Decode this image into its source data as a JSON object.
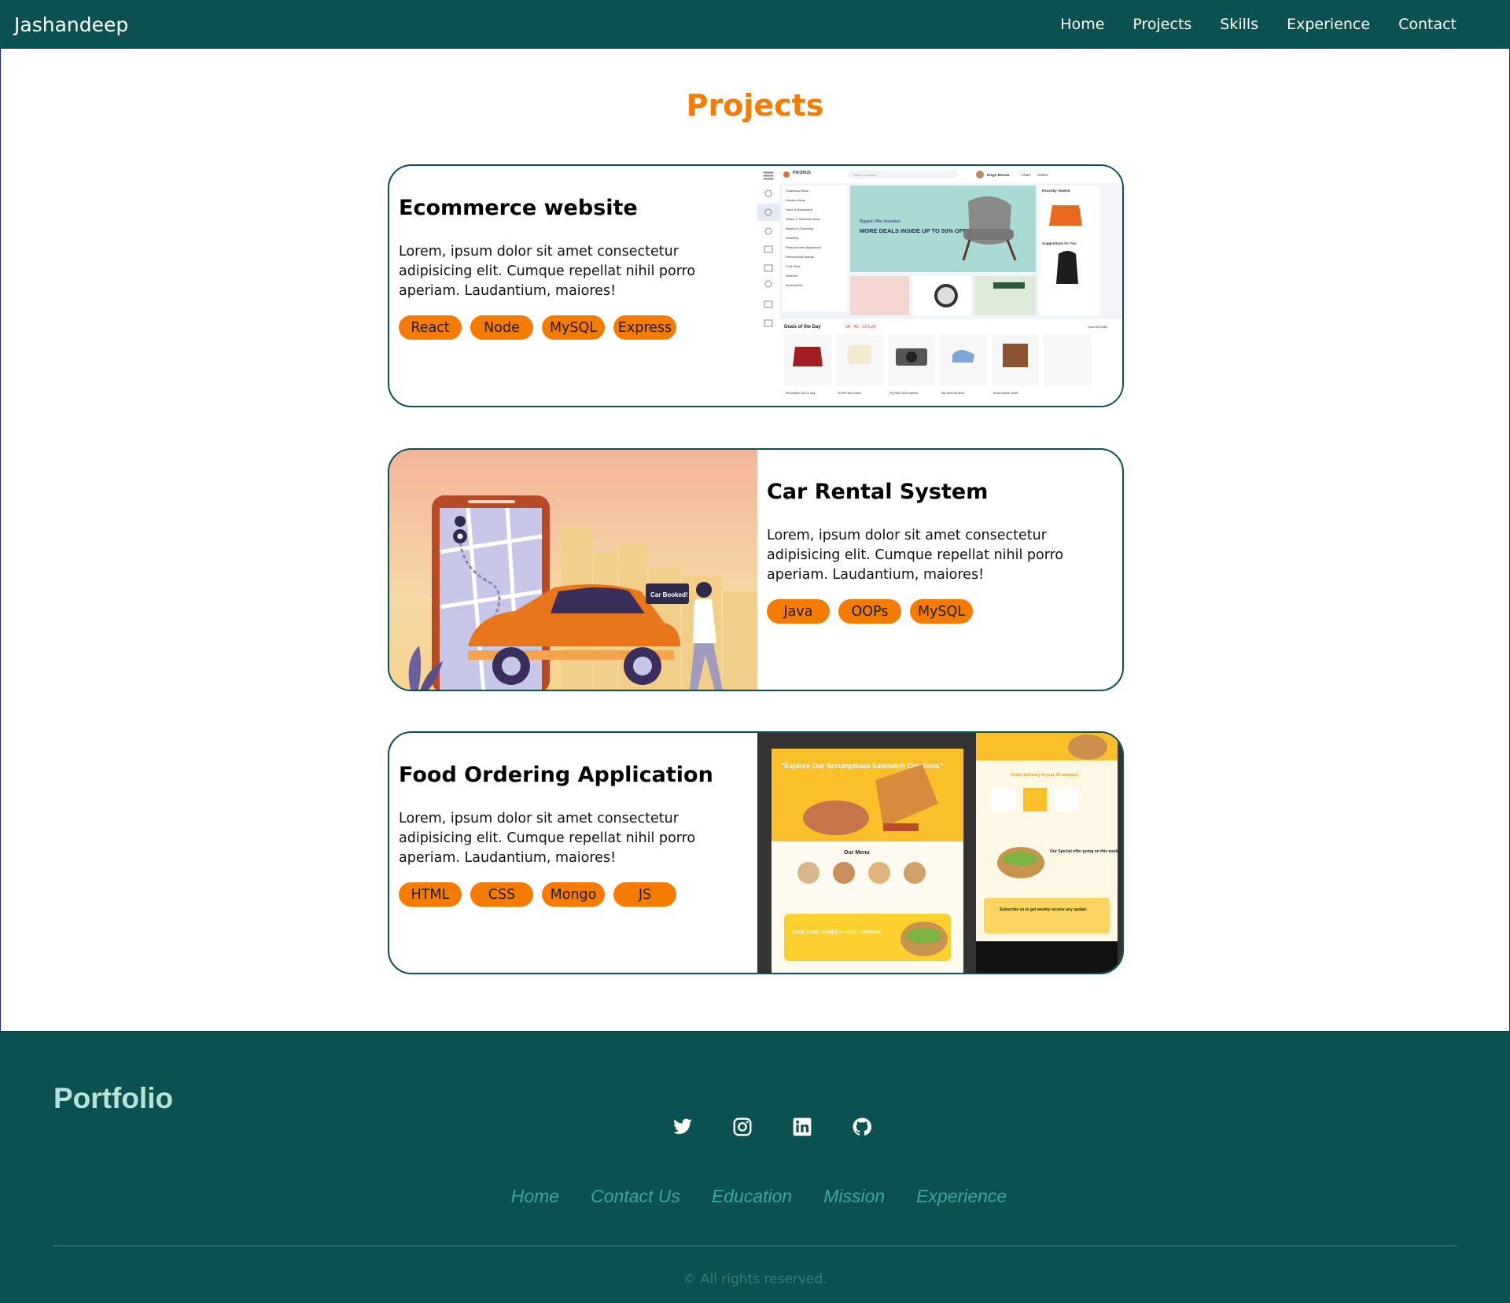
{
  "navbar": {
    "brand": "Jashandeep",
    "links": [
      "Home",
      "Projects",
      "Skills",
      "Experience",
      "Contact"
    ]
  },
  "projects_section": {
    "title": "Projects",
    "cards": [
      {
        "title": "Ecommerce website",
        "description": "Lorem, ipsum dolor sit amet consectetur adipisicing elit. Cumque repellat nihil porro aperiam. Laudantium, maiores!",
        "tags": [
          "React",
          "Node",
          "MySQL",
          "Express"
        ],
        "screenshot": {
          "logo": "PIKORUS",
          "search_placeholder": "Search products",
          "user": "Diego Morata",
          "header_links": [
            "Chart",
            "Orders"
          ],
          "categories": [
            "Traditional Wear",
            "Western Wear",
            "Swim & Beachwear",
            "Winter & Seasonal Wear",
            "Beauty & Grooming",
            "Jewellery",
            "Personal care Appliances",
            "International Brands",
            "Foot Wear",
            "Watches",
            "Accessories"
          ],
          "banner_small": "Biggest Offer Revealed",
          "banner_big": "MORE DEALS INSIDE UP TO 50% OFF",
          "recently_viewed": "Recently Viewed",
          "suggestions": "Suggestions for You",
          "deals_title": "Deals of the Day",
          "deals_timer": "20 : 45 : 12  Left",
          "view_all": "View All Deals",
          "deals": [
            "Red leather GUCCI bag",
            "LEXRE face cream",
            "Fuji Film DSLR camera",
            "Sky blue kids shoe",
            "Brown leather wallet"
          ]
        }
      },
      {
        "title": "Car Rental System",
        "description": "Lorem, ipsum dolor sit amet consectetur adipisicing elit. Cumque repellat nihil porro aperiam. Laudantium, maiores!",
        "tags": [
          "Java",
          "OOPs",
          "MySQL"
        ],
        "illustration": {
          "bubble": "Car Booked!"
        }
      },
      {
        "title": "Food Ordering Application",
        "description": "Lorem, ipsum dolor sit amet consectetur adipisicing elit. Cumque repellat nihil porro aperiam. Laudantium, maiores!",
        "tags": [
          "HTML",
          "CSS",
          "Mongo",
          "JS"
        ],
        "screenshot": {
          "hero": "\"Explore Our Scrumptious Sandwich Creations\"",
          "menu_title": "Our Menu",
          "special": "GOOD FOOD, DRINKS & GREAT COMPANY.",
          "delivery": "Order Delivery in just 30 minutes",
          "offer": "Our Special offer going on this week.",
          "subscribe": "Subscribe us to get weekly receive any update"
        }
      }
    ]
  },
  "footer": {
    "brand": "Portfolio",
    "socials": [
      "twitter-icon",
      "instagram-icon",
      "linkedin-icon",
      "github-icon"
    ],
    "links": [
      "Home",
      "Contact Us",
      "Education",
      "Mission",
      "Experience"
    ],
    "copyright": "© All rights reserved."
  },
  "colors": {
    "primary": "#0b5150",
    "accent": "#f57c00",
    "footer_link": "#3fa59a"
  }
}
